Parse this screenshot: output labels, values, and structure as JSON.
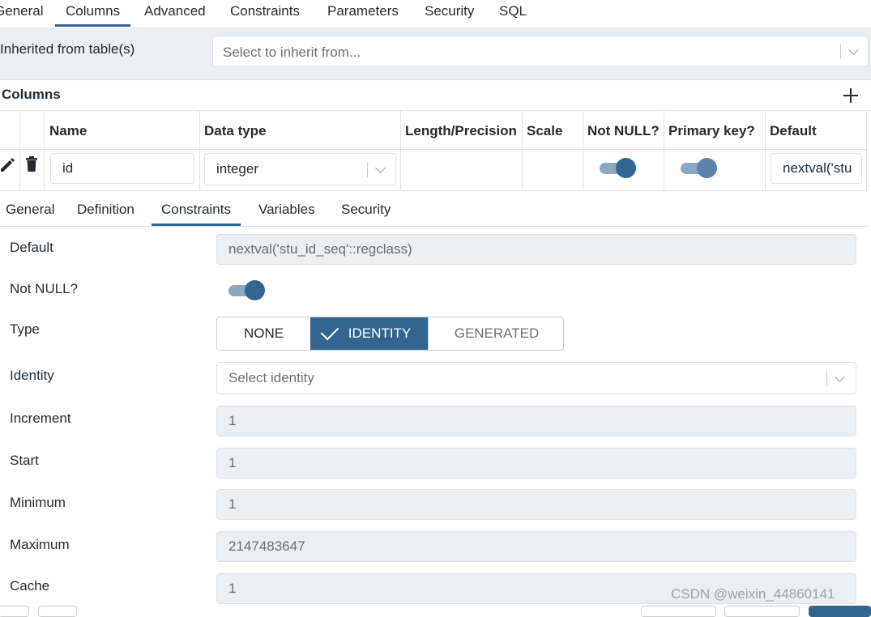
{
  "top_tabs": [
    "General",
    "Columns",
    "Advanced",
    "Constraints",
    "Parameters",
    "Security",
    "SQL"
  ],
  "inherit": {
    "label": "Inherited from table(s)",
    "placeholder": "Select to inherit from..."
  },
  "columns": {
    "title": "Columns",
    "headers": [
      "Name",
      "Data type",
      "Length/Precision",
      "Scale",
      "Not NULL?",
      "Primary key?",
      "Default"
    ],
    "row": {
      "name": "id",
      "data_type": "integer",
      "length": "",
      "scale": "",
      "not_null": true,
      "primary_key": true,
      "default": "nextval('stu"
    }
  },
  "sub_tabs": [
    "General",
    "Definition",
    "Constraints",
    "Variables",
    "Security"
  ],
  "form": {
    "default_label": "Default",
    "default_value": "nextval('stu_id_seq'::regclass)",
    "not_null_label": "Not NULL?",
    "not_null_value": true,
    "type_label": "Type",
    "type_options": [
      "NONE",
      "IDENTITY",
      "GENERATED"
    ],
    "type_selected": "IDENTITY",
    "identity_label": "Identity",
    "identity_placeholder": "Select identity",
    "increment_label": "Increment",
    "increment_value": "1",
    "start_label": "Start",
    "start_value": "1",
    "minimum_label": "Minimum",
    "minimum_value": "1",
    "maximum_label": "Maximum",
    "maximum_value": "2147483647",
    "cache_label": "Cache",
    "cache_value": "1"
  },
  "watermark": "CSDN @weixin_44860141",
  "colors": {
    "accent": "#326690",
    "accent_light": "#8aa8c4",
    "readonly_bg": "#ebeef3",
    "border": "#dde0e6"
  }
}
